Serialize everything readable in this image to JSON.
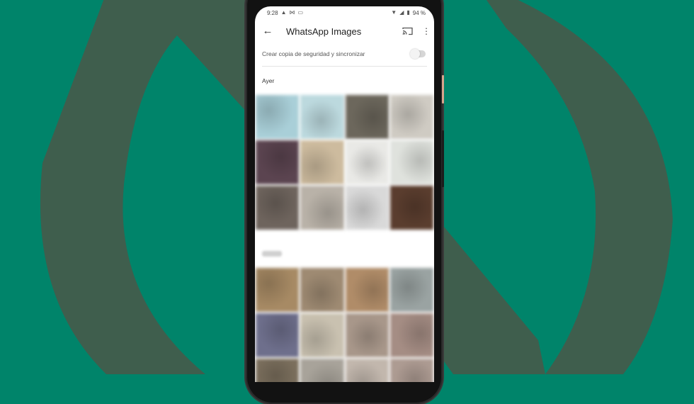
{
  "background": {
    "primary_color": "#00846a",
    "logo_color": "#3f5e4d"
  },
  "status_bar": {
    "time": "9:28",
    "left_icons": [
      "cloud-icon",
      "mail-icon",
      "cast-notification-icon"
    ],
    "right_icons": [
      "wifi-icon",
      "signal-icon",
      "battery-icon"
    ],
    "battery": "94 %"
  },
  "app_bar": {
    "back_icon": "arrow-left-icon",
    "title": "WhatsApp Images",
    "cast_icon": "cast-icon",
    "more_icon": "more-vert-icon"
  },
  "backup": {
    "label": "Crear copia de seguridad y sincronizar",
    "toggle_on": false
  },
  "sections": [
    {
      "label": "Ayer",
      "thumbnails": [
        "#a9cfd8",
        "#bcd9de",
        "#6c675c",
        "#cfcbc3",
        "#5b4450",
        "#cdbb9e",
        "#e9e9e6",
        "#dfe2dd",
        "#6e645d",
        "#b9b2a8",
        "#d9d9d9",
        "#5a3d2e"
      ]
    },
    {
      "label": "",
      "thumbnails": [
        "#a78a64",
        "#9e8a72",
        "#b08c68",
        "#9aa3a2",
        "#6e6f8c",
        "#c9c1b0",
        "#a8978a",
        "#a58d84",
        "#7b6f5d",
        "#a8a39a",
        "#c2b7ad",
        "#ad9b92"
      ]
    }
  ]
}
